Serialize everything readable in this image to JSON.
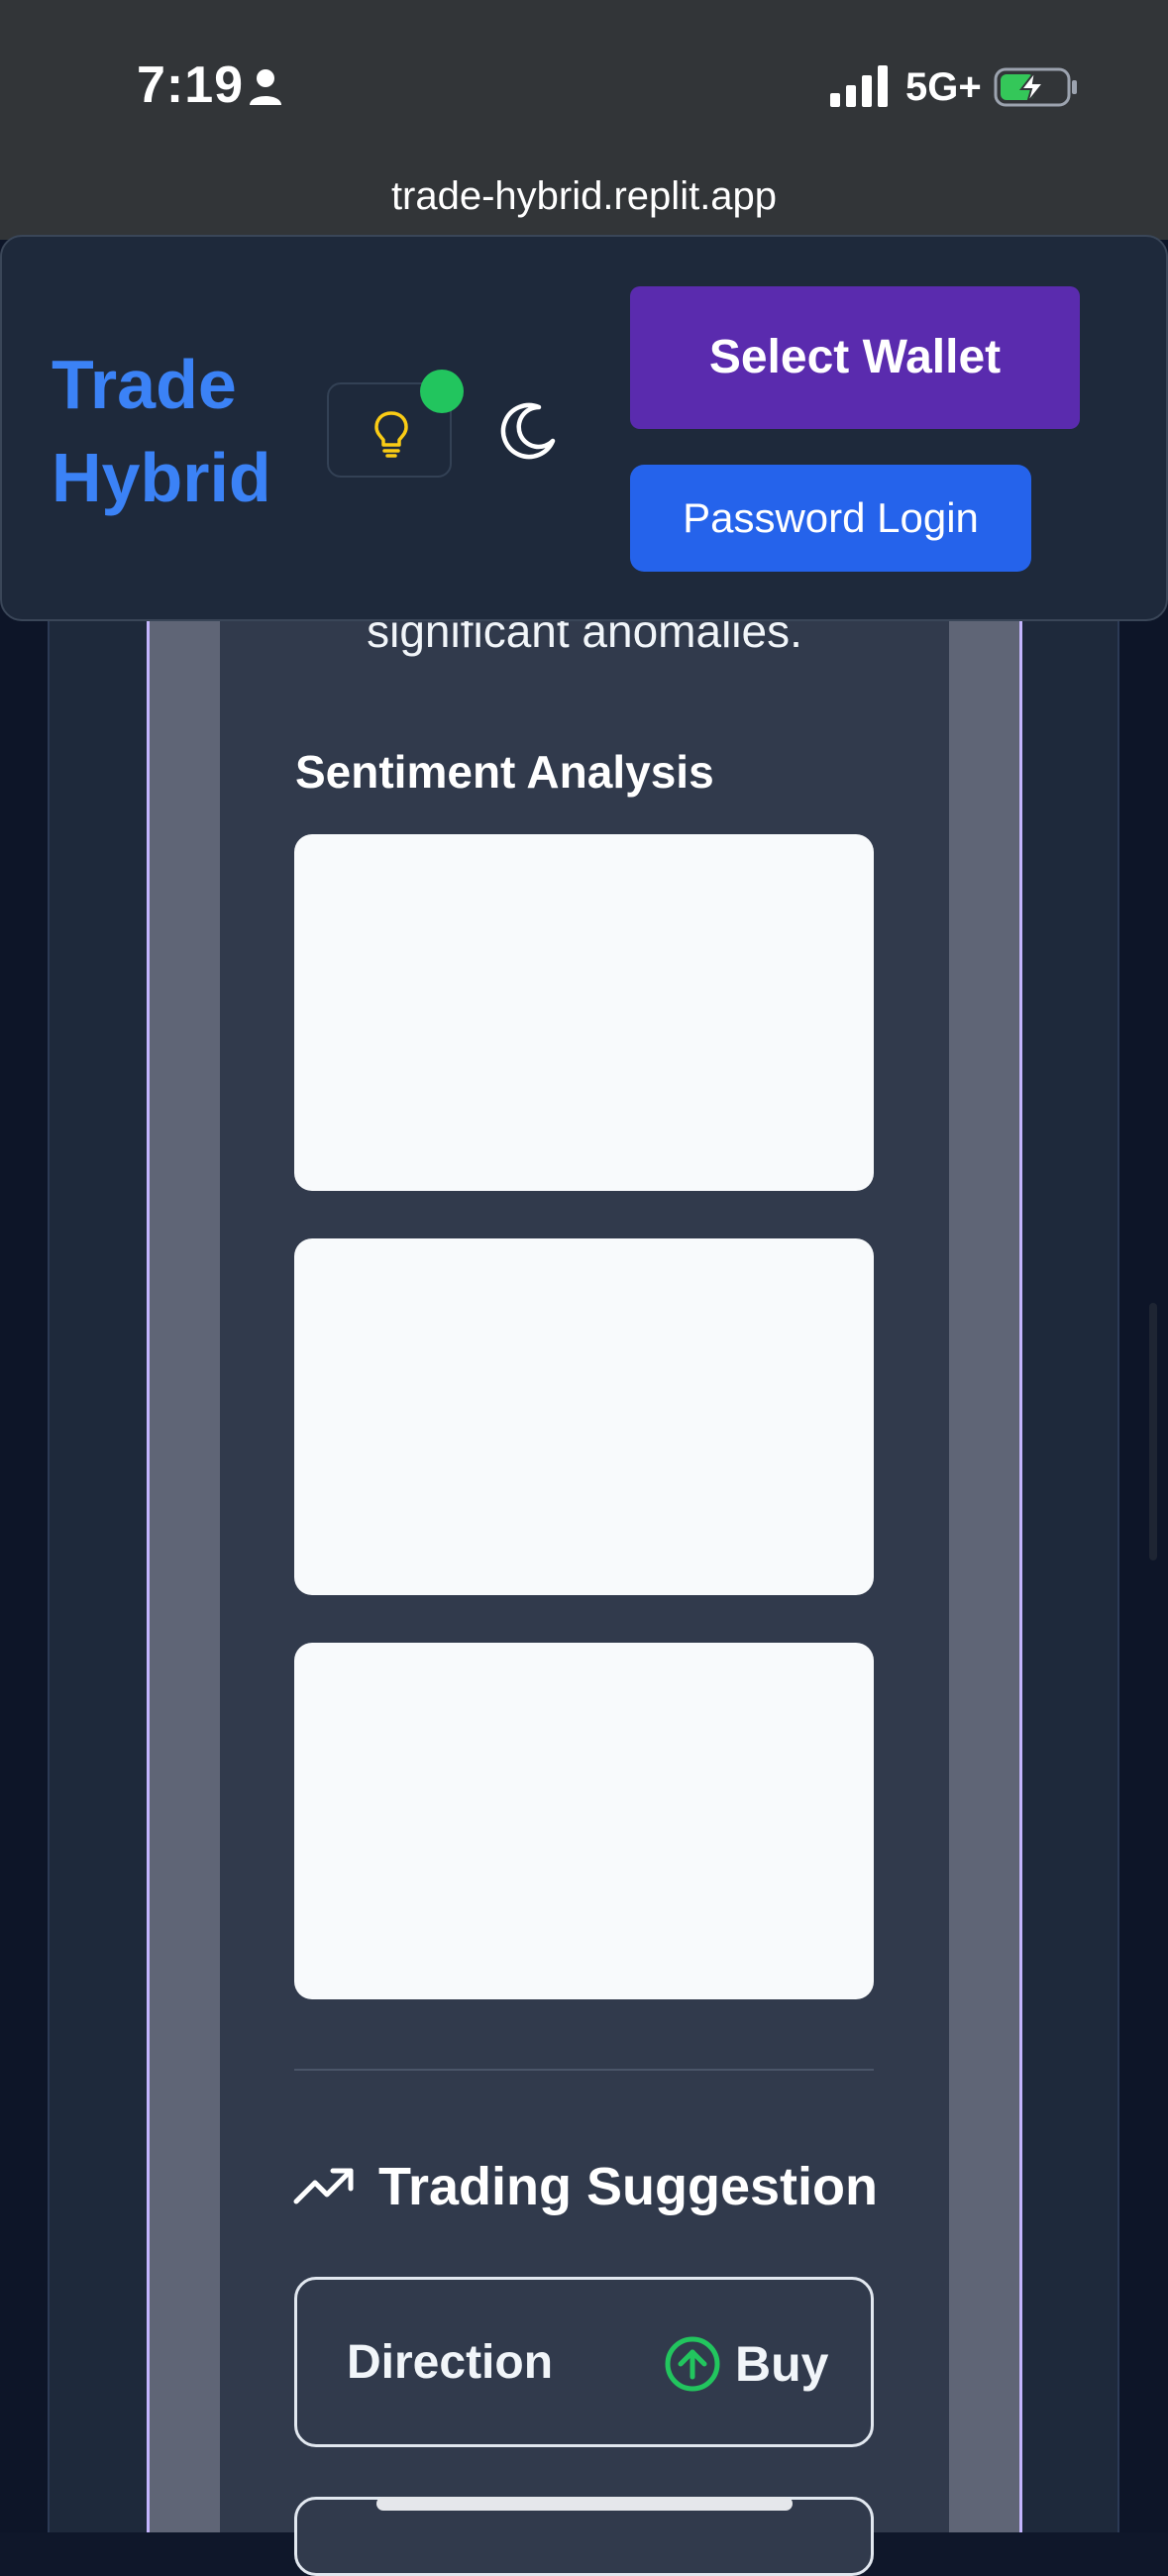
{
  "status_bar": {
    "time": "7:19",
    "network": "5G+"
  },
  "browser": {
    "url": "trade-hybrid.replit.app"
  },
  "header": {
    "brand_line1": "Trade",
    "brand_line2": "Hybrid",
    "select_wallet_label": "Select Wallet",
    "password_login_label": "Password Login"
  },
  "content": {
    "anomalies_text": "significant anomalies.",
    "sentiment_title": "Sentiment Analysis",
    "trading_title": "Trading Suggestion",
    "direction_label": "Direction",
    "direction_value": "Buy"
  },
  "colors": {
    "brand": "#3b82f6",
    "wallet_button": "#5a2bae",
    "login_button": "#2563eb",
    "buy_green": "#22c55e",
    "status_dot": "#22c55e",
    "bulb": "#facc15"
  },
  "icons": {
    "person": "person-icon",
    "signal": "signal-icon",
    "battery": "battery-charging-icon",
    "idea": "lightbulb-icon",
    "theme": "moon-icon",
    "trend": "trending-up-icon",
    "direction": "arrow-up-circle-icon"
  }
}
